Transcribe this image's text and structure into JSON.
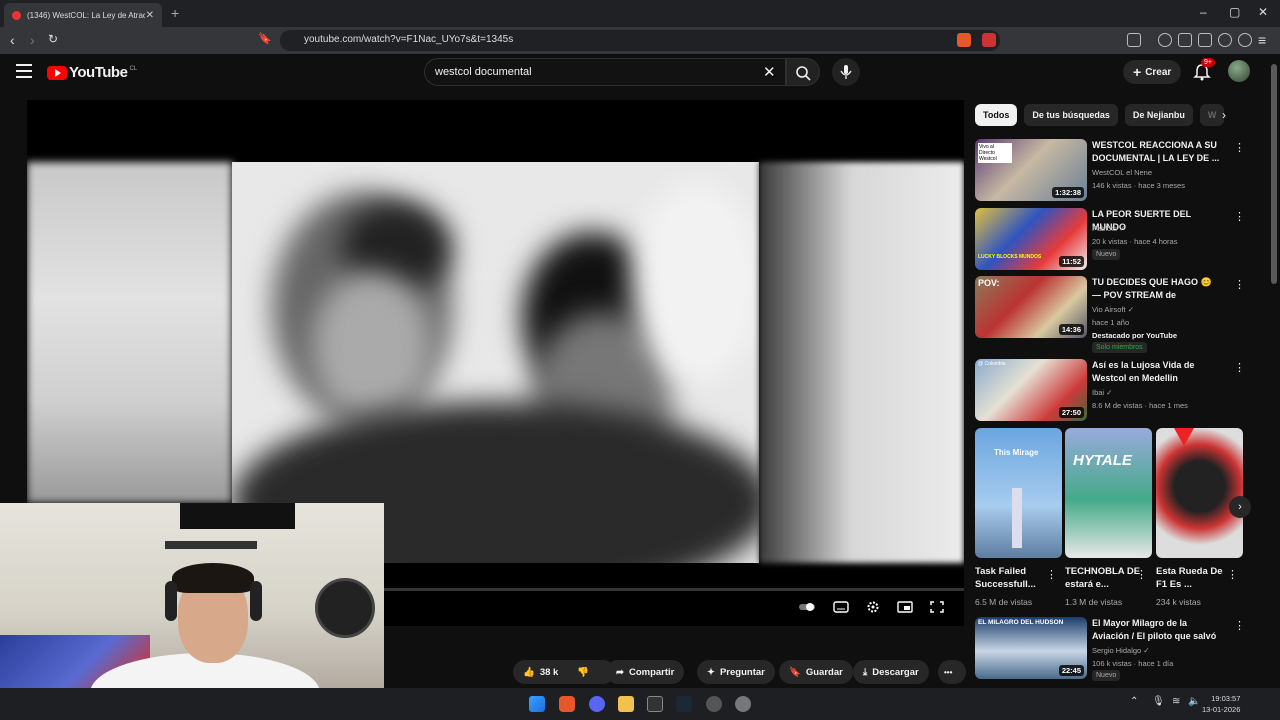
{
  "browser": {
    "tab_title": "(1346) WestCOL: La Ley de Atraco",
    "url": "youtube.com/watch?v=F1Nac_UYo7s&t=1345s",
    "new_tab": "+",
    "minimize": "–",
    "maximize": "▢",
    "close": "✕"
  },
  "youtube": {
    "logo_text": "YouTube",
    "country": "CL",
    "search_value": "westcol documental",
    "create_label": "Crear",
    "notif_badge": "9+"
  },
  "actions": {
    "likes": "38 k",
    "share": "Compartir",
    "ask": "Preguntar",
    "save": "Guardar",
    "download": "Descargar",
    "more": "•••"
  },
  "chips": [
    "Todos",
    "De tus búsquedas",
    "De Nejianbu",
    "W"
  ],
  "recommendations": [
    {
      "title": "WESTCOL REACCIONA A SU DOCUMENTAL | LA LEY DE ...",
      "channel": "WestCOL el Nene",
      "meta": "146 k vistas · hace 3 meses",
      "duration": "1:32:38",
      "badge": ""
    },
    {
      "title": "LA PEOR SUERTE DEL MUNDO",
      "channel": "Pablots ✓",
      "meta": "20 k vistas · hace 4 horas",
      "duration": "11:52",
      "badge": "Nuevo"
    },
    {
      "title": "TU DECIDES QUE HAGO 😊 — POV STREAM de AIRSOFT...",
      "channel": "Vio Airsoft ✓",
      "meta": "hace 1 año",
      "duration": "14:36",
      "badge": "Destacado por YouTube",
      "members": "Solo miembros"
    },
    {
      "title": "Así es la Lujosa Vida de Westcol en Medellin",
      "channel": "Ibai ✓",
      "meta": "8.6 M de vistas · hace 1 mes",
      "duration": "27:50",
      "badge": ""
    },
    {
      "title": "El Mayor Milagro de la Aviación / El piloto que salvó a 155 ...",
      "channel": "Sergio Hidalgo ✓",
      "meta": "106 k vistas · hace 1 día",
      "duration": "22:45",
      "badge": "Nuevo"
    }
  ],
  "shorts": [
    {
      "title": "Task Failed Successfull...",
      "views": "6.5 M de vistas",
      "thumb_text": "This Mirage"
    },
    {
      "title": "TECHNOBLA DE estará e...",
      "views": "1.3 M de vistas",
      "thumb_text": "HYTALE"
    },
    {
      "title": "Esta Rueda De F1 Es ...",
      "views": "234 k vistas",
      "thumb_text": ""
    }
  ],
  "thumb_texts": {
    "rec1_top": "Vivo al Directo Westcol",
    "rec3_top": "POV:",
    "rec4_top": "@ Colombia",
    "rec5_top": "EL MILAGRO DEL HUDSON",
    "rec2_bottom": "LUCKY BLOCKS MUNDOS"
  },
  "clock": {
    "time": "19:03:57",
    "date": "13-01-2026"
  },
  "colors": {
    "accent": "#ff0000",
    "background": "#0f0f0f",
    "member_green": "#2ba640"
  }
}
